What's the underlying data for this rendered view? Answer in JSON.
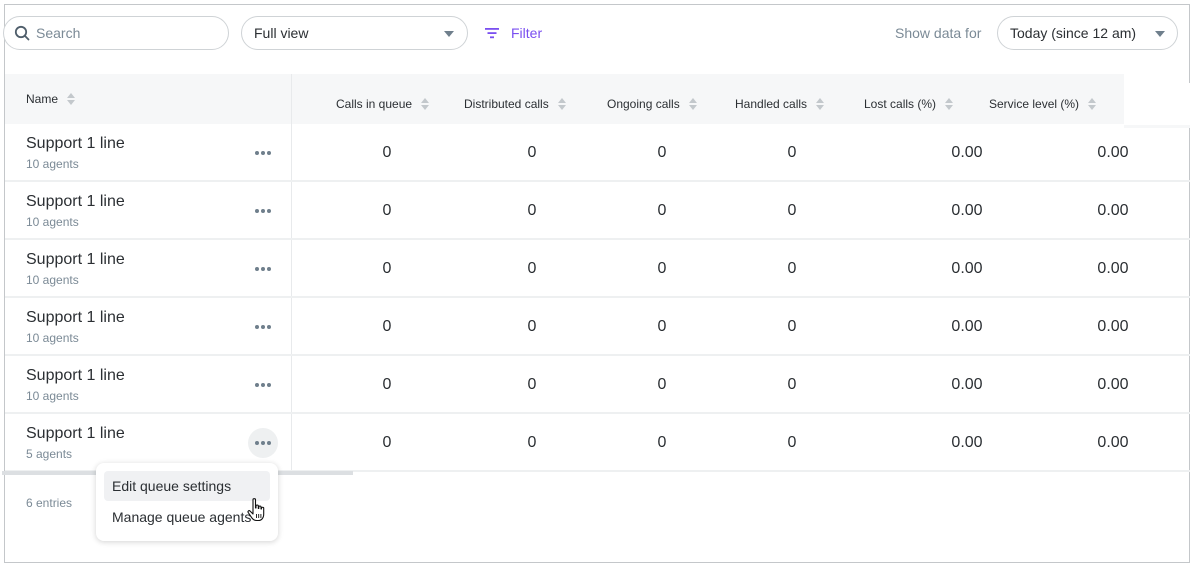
{
  "toolbar": {
    "search_placeholder": "Search",
    "search_value": "",
    "view_select": "Full view",
    "filter_label": "Filter",
    "show_data_label": "Show data for",
    "period_select": "Today (since 12 am)"
  },
  "table": {
    "name_header": "Name",
    "columns": [
      "Calls in queue",
      "Distributed calls",
      "Ongoing calls",
      "Handled calls",
      "Lost calls (%)",
      "Service level (%)"
    ],
    "rows": [
      {
        "name": "Support 1 line",
        "agents": "10 agents",
        "values": [
          "0",
          "0",
          "0",
          "0",
          "0.00",
          "0.00"
        ]
      },
      {
        "name": "Support 1 line",
        "agents": "10 agents",
        "values": [
          "0",
          "0",
          "0",
          "0",
          "0.00",
          "0.00"
        ]
      },
      {
        "name": "Support 1 line",
        "agents": "10 agents",
        "values": [
          "0",
          "0",
          "0",
          "0",
          "0.00",
          "0.00"
        ]
      },
      {
        "name": "Support 1 line",
        "agents": "10 agents",
        "values": [
          "0",
          "0",
          "0",
          "0",
          "0.00",
          "0.00"
        ]
      },
      {
        "name": "Support 1 line",
        "agents": "10 agents",
        "values": [
          "0",
          "0",
          "0",
          "0",
          "0.00",
          "0.00"
        ]
      },
      {
        "name": "Support 1 line",
        "agents": "5 agents",
        "values": [
          "0",
          "0",
          "0",
          "0",
          "0.00",
          "0.00"
        ]
      }
    ],
    "entries_count": "6 entries"
  },
  "row_menu": {
    "items": [
      "Edit queue settings",
      "Manage queue agents"
    ],
    "hovered_index": 0
  },
  "colors": {
    "accent": "#7a4ff0",
    "muted_text": "#7b8a96",
    "header_bg": "#f6f7f8"
  }
}
